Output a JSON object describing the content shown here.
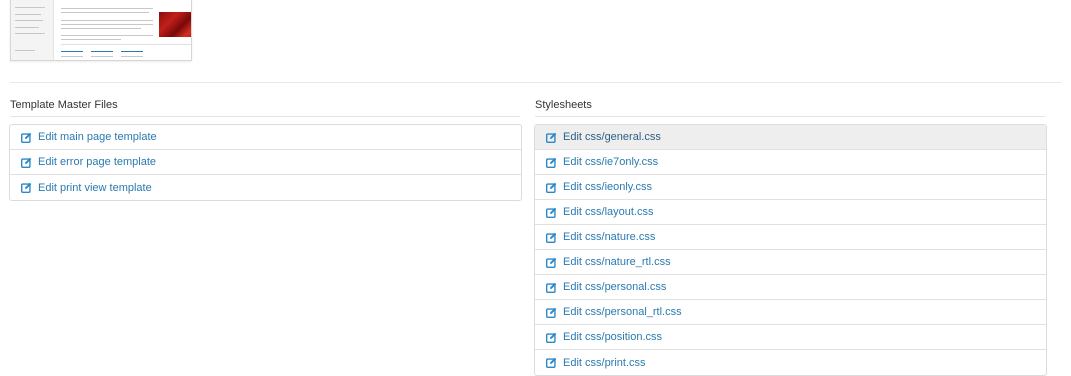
{
  "template_master": {
    "heading": "Template Master Files",
    "items": [
      {
        "label": "Edit main page template"
      },
      {
        "label": "Edit error page template"
      },
      {
        "label": "Edit print view template"
      }
    ]
  },
  "stylesheets": {
    "heading": "Stylesheets",
    "items": [
      {
        "label": "Edit css/general.css",
        "active": true
      },
      {
        "label": "Edit css/ie7only.css"
      },
      {
        "label": "Edit css/ieonly.css"
      },
      {
        "label": "Edit css/layout.css"
      },
      {
        "label": "Edit css/nature.css"
      },
      {
        "label": "Edit css/nature_rtl.css"
      },
      {
        "label": "Edit css/personal.css"
      },
      {
        "label": "Edit css/personal_rtl.css"
      },
      {
        "label": "Edit css/position.css"
      },
      {
        "label": "Edit css/print.css"
      }
    ]
  },
  "colors": {
    "link": "#2a7ab0",
    "active_bg": "#eeeeee",
    "icon": "#2a88c8"
  },
  "icons": {
    "edit": "edit-icon"
  }
}
